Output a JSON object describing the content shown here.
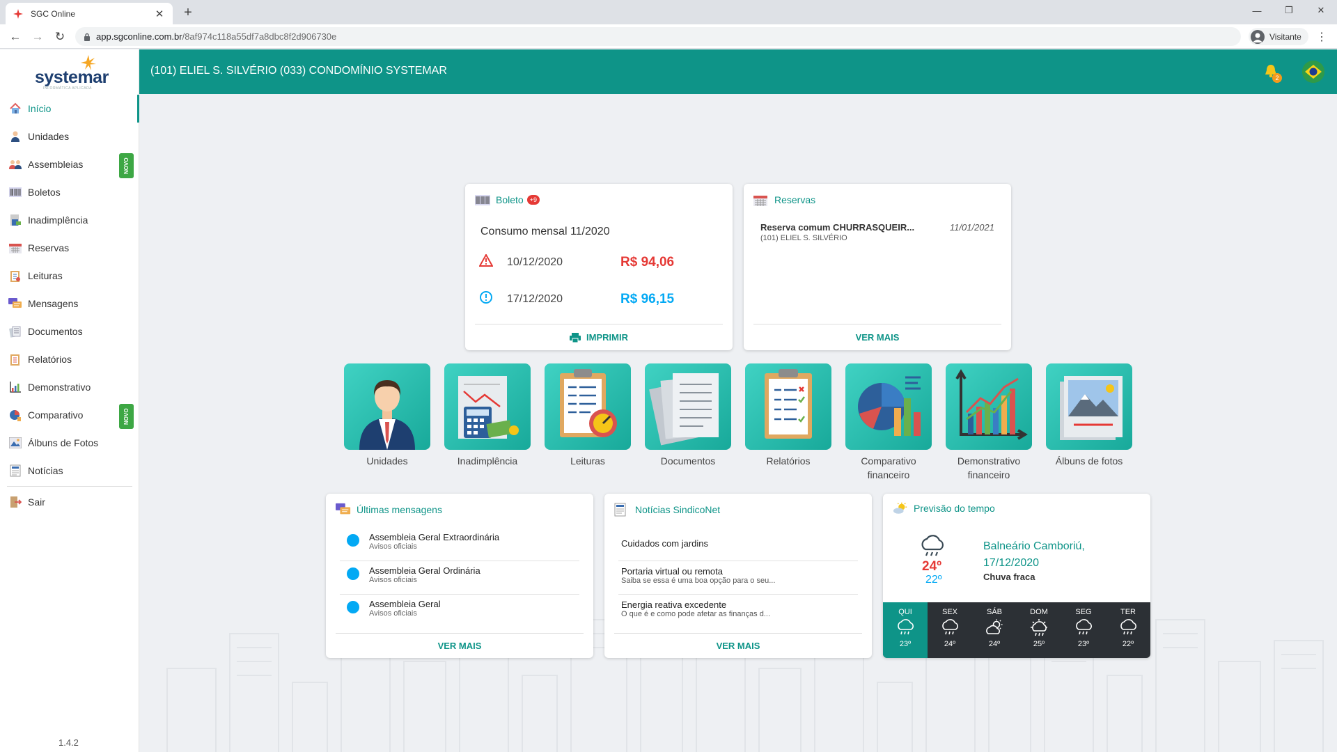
{
  "browser": {
    "tab_title": "SGC Online",
    "url_host": "app.sgconline.com.br",
    "url_path": "/8af974c118a55df7a8dbc8f2d906730e",
    "profile_label": "Visitante"
  },
  "sidebar": {
    "logo_text": "systemar",
    "logo_sub": "INFORMÁTICA APLICADA",
    "items": [
      {
        "label": "Início",
        "icon": "home-icon",
        "active": true
      },
      {
        "label": "Unidades",
        "icon": "person-icon"
      },
      {
        "label": "Assembleias",
        "icon": "people-icon",
        "badge": "NOVO"
      },
      {
        "label": "Boletos",
        "icon": "barcode-icon"
      },
      {
        "label": "Inadimplência",
        "icon": "finance-icon"
      },
      {
        "label": "Reservas",
        "icon": "calendar-icon"
      },
      {
        "label": "Leituras",
        "icon": "clipboard-icon"
      },
      {
        "label": "Mensagens",
        "icon": "chat-icon"
      },
      {
        "label": "Documentos",
        "icon": "documents-icon"
      },
      {
        "label": "Relatórios",
        "icon": "report-icon"
      },
      {
        "label": "Demonstrativo",
        "icon": "chart-icon"
      },
      {
        "label": "Comparativo",
        "icon": "pie-icon",
        "badge": "NOVO"
      },
      {
        "label": "Álbuns de Fotos",
        "icon": "photo-icon"
      },
      {
        "label": "Notícias",
        "icon": "news-icon"
      }
    ],
    "logout_label": "Sair",
    "version": "1.4.2"
  },
  "topbar": {
    "title": "(101) ELIEL S. SILVÉRIO  (033) CONDOMÍNIO SYSTEMAR",
    "notification_count": "2"
  },
  "boleto": {
    "title": "Boleto",
    "badge": "+9",
    "subtitle": "Consumo mensal 11/2020",
    "rows": [
      {
        "date": "10/12/2020",
        "value": "R$ 94,06",
        "status": "overdue",
        "color": "#e53935"
      },
      {
        "date": "17/12/2020",
        "value": "R$ 96,15",
        "status": "pending",
        "color": "#03a9f4"
      }
    ],
    "action": "IMPRIMIR"
  },
  "reservas": {
    "title": "Reservas",
    "item_title": "Reserva comum CHURRASQUEIR...",
    "item_date": "11/01/2021",
    "item_sub": "(101) ELIEL S. SILVÉRIO",
    "action": "VER MAIS"
  },
  "tiles": [
    {
      "label": "Unidades"
    },
    {
      "label": "Inadimplência"
    },
    {
      "label": "Leituras"
    },
    {
      "label": "Documentos"
    },
    {
      "label": "Relatórios"
    },
    {
      "label": "Comparativo financeiro"
    },
    {
      "label": "Demonstrativo financeiro"
    },
    {
      "label": "Álbuns de fotos"
    }
  ],
  "mensagens": {
    "title": "Últimas mensagens",
    "items": [
      {
        "title": "Assembleia Geral Extraordinária",
        "sub": "Avisos oficiais"
      },
      {
        "title": "Assembleia Geral Ordinária",
        "sub": "Avisos oficiais"
      },
      {
        "title": "Assembleia Geral",
        "sub": "Avisos oficiais"
      }
    ],
    "action": "VER MAIS"
  },
  "noticias": {
    "title": "Notícias SindicoNet",
    "items": [
      {
        "title": "Cuidados com jardins",
        "sub": ""
      },
      {
        "title": "Portaria virtual ou remota",
        "sub": "Saiba se essa é uma boa opção para o seu..."
      },
      {
        "title": "Energia reativa excedente",
        "sub": "O que é e como pode afetar as finanças d..."
      }
    ],
    "action": "VER MAIS"
  },
  "tempo": {
    "title": "Previsão do tempo",
    "city": "Balneário Camboriú,",
    "date": "17/12/2020",
    "condition": "Chuva fraca",
    "high": "24º",
    "low": "22º",
    "forecast": [
      {
        "day": "QUI",
        "temp": "23º",
        "icon": "rain-icon",
        "today": true
      },
      {
        "day": "SEX",
        "temp": "24º",
        "icon": "rain-icon"
      },
      {
        "day": "SÁB",
        "temp": "24º",
        "icon": "partly-cloudy-icon"
      },
      {
        "day": "DOM",
        "temp": "25º",
        "icon": "sun-rain-icon"
      },
      {
        "day": "SEG",
        "temp": "23º",
        "icon": "rain-icon"
      },
      {
        "day": "TER",
        "temp": "22º",
        "icon": "rain-icon"
      }
    ]
  },
  "colors": {
    "accent": "#0e9488",
    "overdue": "#e53935",
    "pending": "#03a9f4",
    "novo": "#3da744"
  }
}
